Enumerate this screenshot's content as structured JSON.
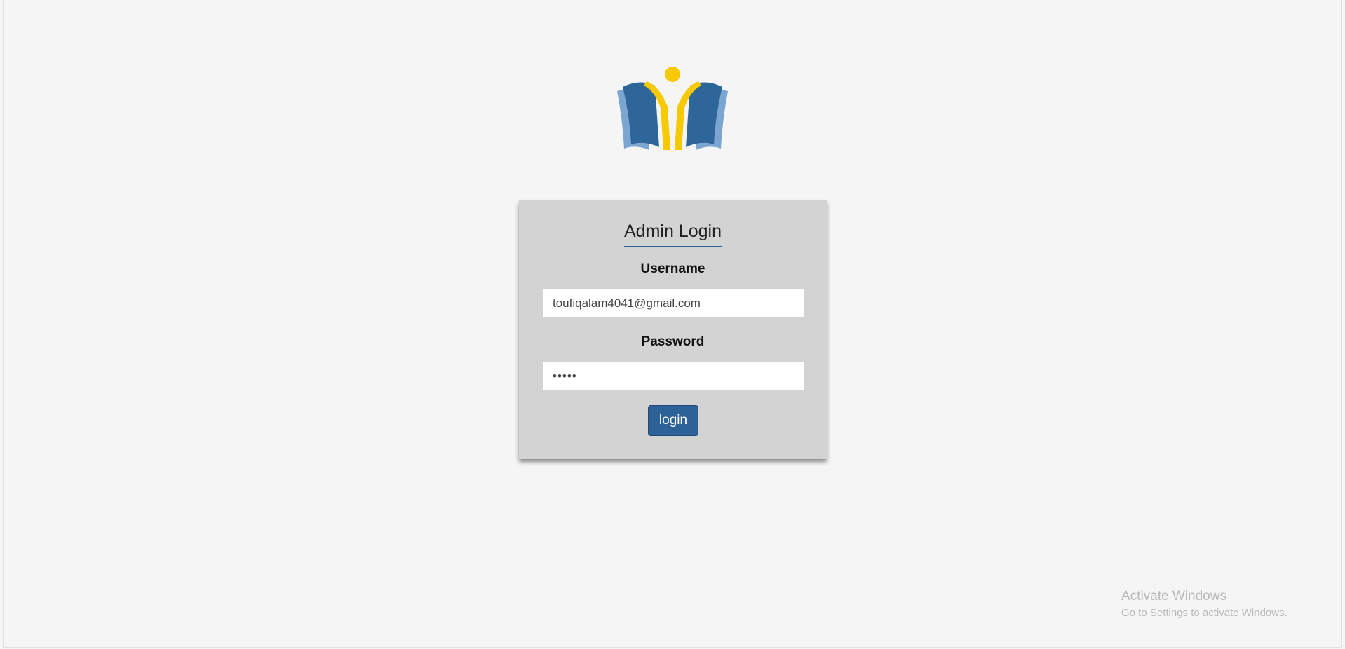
{
  "colors": {
    "background": "#f5f5f5",
    "card": "#d3d3d3",
    "accent": "#2d6299",
    "logo_blue": "#2f6699",
    "logo_light_blue": "#7ba6d2",
    "logo_yellow": "#f7c900"
  },
  "logo": {
    "icon": "open-book-person-logo"
  },
  "login": {
    "title": "Admin Login",
    "username_label": "Username",
    "username_value": "toufiqalam4041@gmail.com",
    "password_label": "Password",
    "password_value": "•••••",
    "button_label": "login"
  },
  "watermark": {
    "title": "Activate Windows",
    "subtitle": "Go to Settings to activate Windows."
  }
}
